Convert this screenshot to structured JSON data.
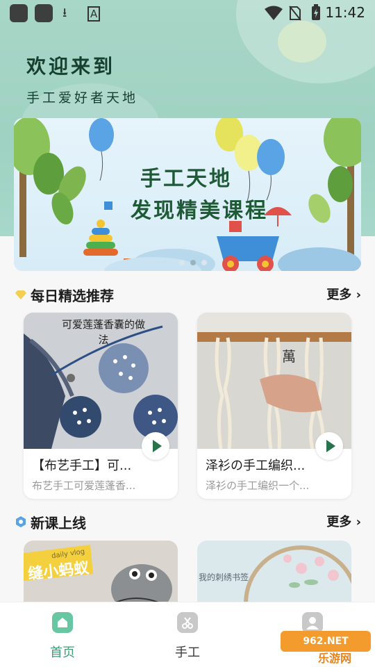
{
  "status_bar": {
    "time": "11:42"
  },
  "greeting": {
    "line1": "欢迎来到",
    "line2": "手工爱好者天地"
  },
  "banner": {
    "line1": "手工天地",
    "line2": "发现精美课程",
    "slide_index": 2,
    "slide_count": 3
  },
  "daily": {
    "title": "每日精选推荐",
    "more": "更多",
    "cards": [
      {
        "title": "【布艺手工】可...",
        "subtitle": "布艺手工可爱莲蓬香...",
        "thumb_text": "可爱莲蓬香囊的做法"
      },
      {
        "title": "泽衫の手工编织...",
        "subtitle": "泽衫の手工编织一个..."
      }
    ]
  },
  "newcourse": {
    "title": "新课上线",
    "more": "更多",
    "cards": [
      {
        "thumb_text_top": "daily vlog",
        "thumb_text": "缝小蚂蚁"
      },
      {
        "thumb_text": "我的刺绣书签"
      }
    ]
  },
  "tabs": [
    {
      "label": "首页",
      "icon": "home-icon",
      "active": true
    },
    {
      "label": "手工",
      "icon": "scissors-icon",
      "active": false
    },
    {
      "label": "",
      "icon": "profile-icon",
      "active": false
    }
  ],
  "watermark": {
    "brand": "962.NET",
    "sub": "乐游网"
  },
  "colors": {
    "accent": "#3e9c77",
    "hero": "#a8d6c7",
    "title_dark": "#173f2f"
  }
}
